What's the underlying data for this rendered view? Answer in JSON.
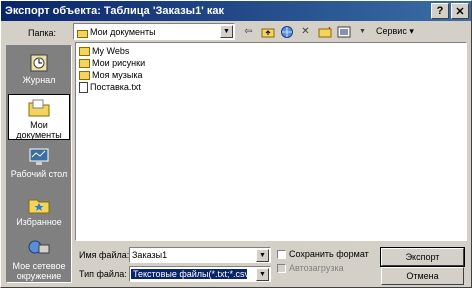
{
  "window": {
    "title": "Экспорт объекта: Таблица 'Заказы1' как",
    "help_btn": "?",
    "close_btn": "✕"
  },
  "look_in": {
    "label": "Папка:",
    "value": "Мои документы"
  },
  "toolbar": {
    "tools_label": "Сервис"
  },
  "places": [
    {
      "label": "Журнал",
      "icon": "history-icon"
    },
    {
      "label": "Мои документы",
      "icon": "my-documents-icon",
      "selected": true
    },
    {
      "label": "Рабочий стол",
      "icon": "desktop-icon"
    },
    {
      "label": "Избранное",
      "icon": "favorites-icon"
    },
    {
      "label": "Мое сетевое окружение",
      "icon": "network-icon"
    }
  ],
  "files": [
    {
      "name": "My Webs",
      "type": "folder"
    },
    {
      "name": "Мои рисунки",
      "type": "folder"
    },
    {
      "name": "Моя музыка",
      "type": "folder"
    },
    {
      "name": "Поставка.txt",
      "type": "text"
    }
  ],
  "form": {
    "filename_label": "Имя файла:",
    "filename_value": "Заказы1",
    "filetype_label": "Тип файла:",
    "filetype_value": "Текстовые файлы(*.txt;*.csv;*.t",
    "save_formatted_label": "Сохранить формат",
    "autostart_label": "Автозагрузка",
    "export_button": "Экспорт",
    "cancel_button": "Отмена"
  },
  "colors": {
    "titlebar_start": "#0a246a",
    "titlebar_end": "#3a6ea5",
    "face": "#d4d0c8",
    "places_bg": "#808080"
  }
}
